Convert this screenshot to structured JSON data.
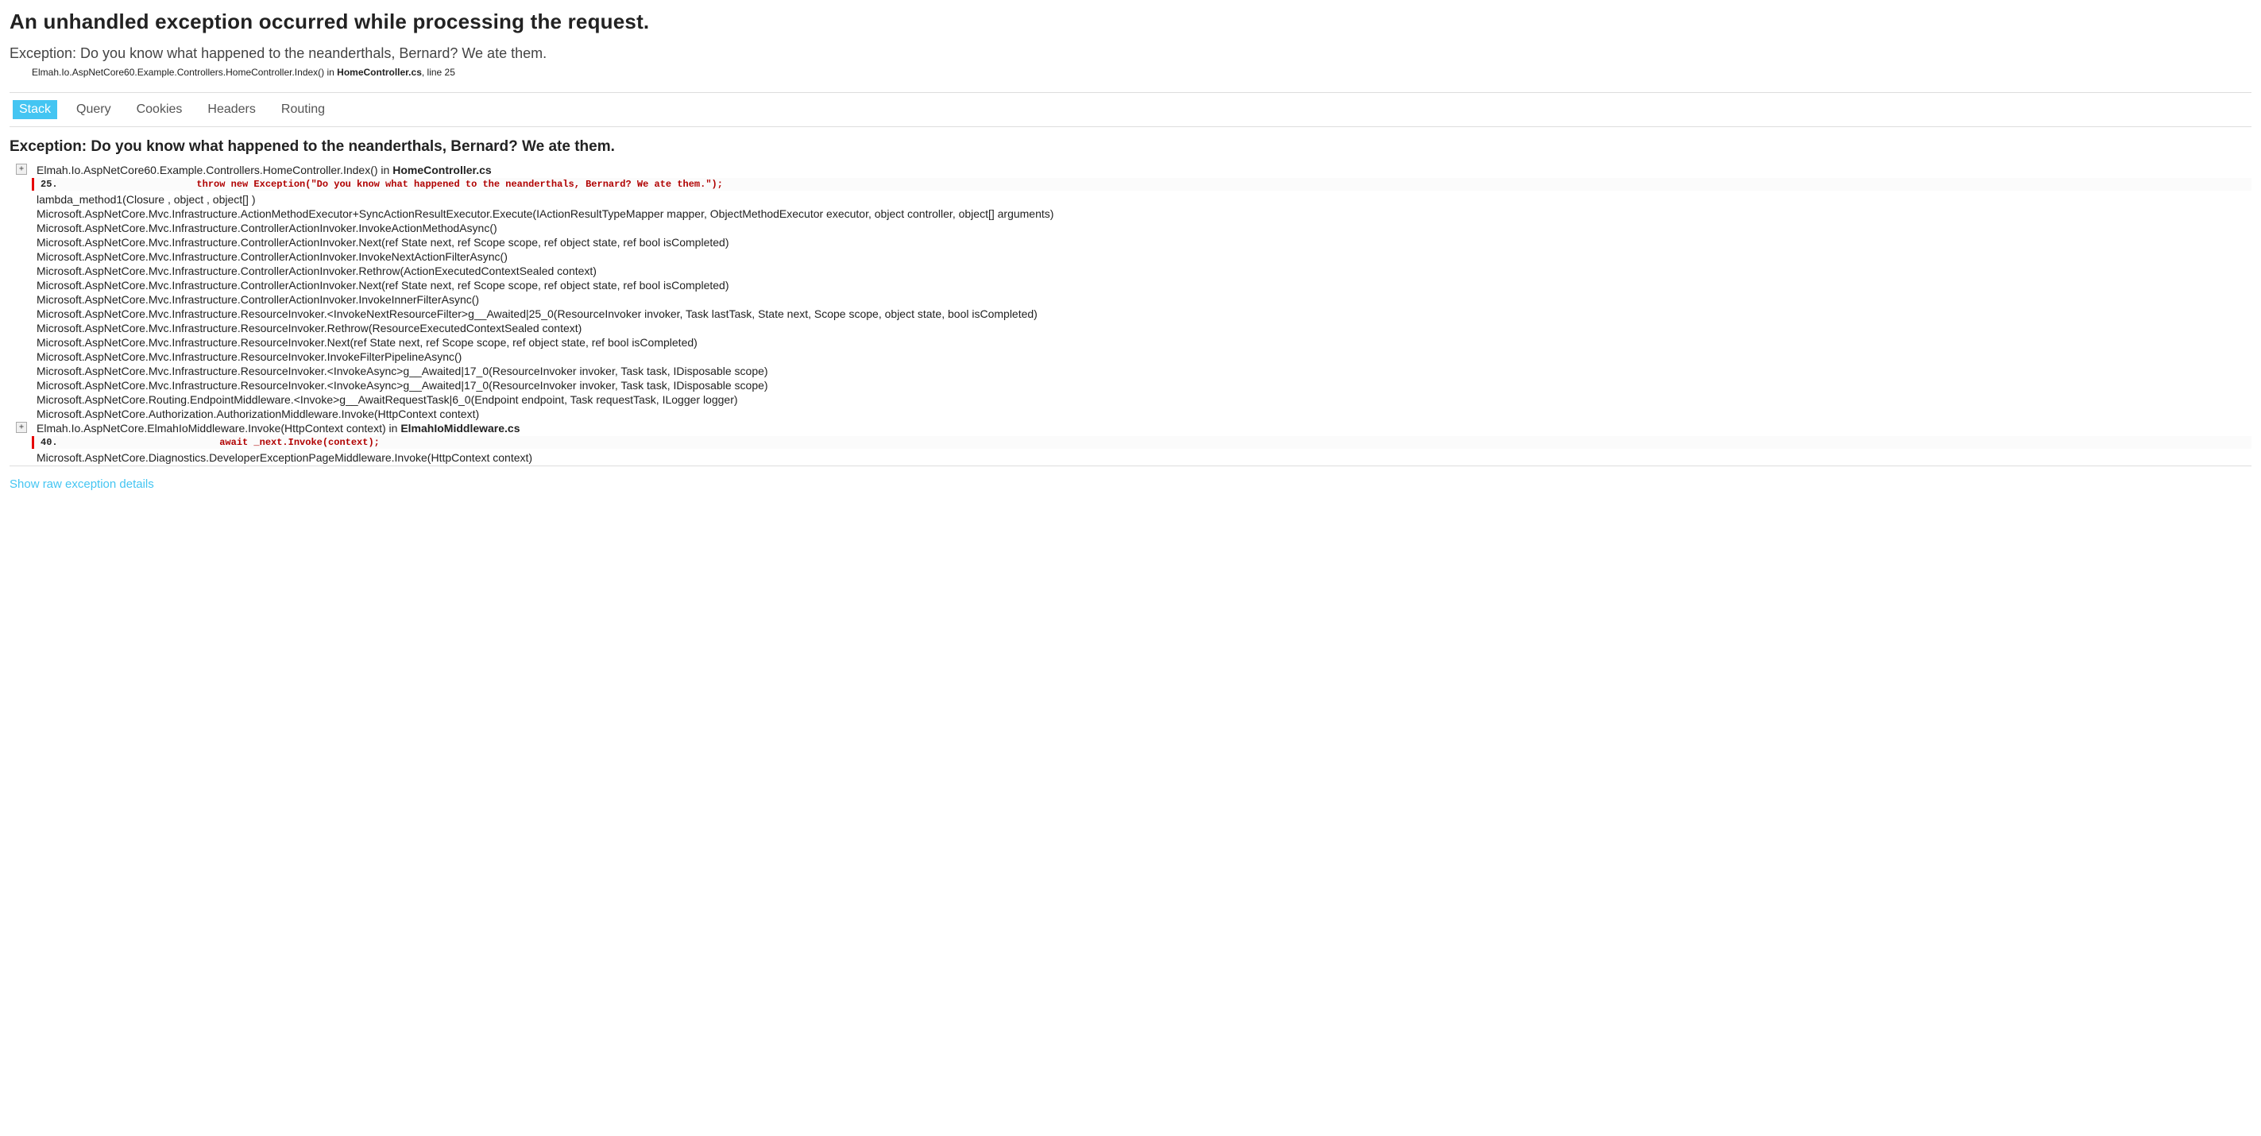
{
  "title": "An unhandled exception occurred while processing the request.",
  "summary": {
    "message": "Exception: Do you know what happened to the neanderthals, Bernard? We ate them.",
    "frame_prefix": "Elmah.Io.AspNetCore60.Example.Controllers.HomeController.Index() in ",
    "frame_file": "HomeController.cs",
    "frame_suffix": ", line 25"
  },
  "tabs": [
    {
      "label": "Stack",
      "active": true
    },
    {
      "label": "Query",
      "active": false
    },
    {
      "label": "Cookies",
      "active": false
    },
    {
      "label": "Headers",
      "active": false
    },
    {
      "label": "Routing",
      "active": false
    }
  ],
  "exception_heading": "Exception: Do you know what happened to the neanderthals, Bernard? We ate them.",
  "frames": [
    {
      "expandable": true,
      "prefix": "Elmah.Io.AspNetCore60.Example.Controllers.HomeController.Index() in ",
      "file": "HomeController.cs",
      "suffix": "",
      "code": {
        "lineno": "25.",
        "src": "            throw new Exception(\"Do you know what happened to the neanderthals, Bernard? We ate them.\");"
      }
    },
    {
      "expandable": false,
      "prefix": "lambda_method1(Closure , object , object[] )",
      "file": "",
      "suffix": ""
    },
    {
      "expandable": false,
      "prefix": "Microsoft.AspNetCore.Mvc.Infrastructure.ActionMethodExecutor+SyncActionResultExecutor.Execute(IActionResultTypeMapper mapper, ObjectMethodExecutor executor, object controller, object[] arguments)",
      "file": "",
      "suffix": ""
    },
    {
      "expandable": false,
      "prefix": "Microsoft.AspNetCore.Mvc.Infrastructure.ControllerActionInvoker.InvokeActionMethodAsync()",
      "file": "",
      "suffix": ""
    },
    {
      "expandable": false,
      "prefix": "Microsoft.AspNetCore.Mvc.Infrastructure.ControllerActionInvoker.Next(ref State next, ref Scope scope, ref object state, ref bool isCompleted)",
      "file": "",
      "suffix": ""
    },
    {
      "expandable": false,
      "prefix": "Microsoft.AspNetCore.Mvc.Infrastructure.ControllerActionInvoker.InvokeNextActionFilterAsync()",
      "file": "",
      "suffix": ""
    },
    {
      "expandable": false,
      "prefix": "Microsoft.AspNetCore.Mvc.Infrastructure.ControllerActionInvoker.Rethrow(ActionExecutedContextSealed context)",
      "file": "",
      "suffix": ""
    },
    {
      "expandable": false,
      "prefix": "Microsoft.AspNetCore.Mvc.Infrastructure.ControllerActionInvoker.Next(ref State next, ref Scope scope, ref object state, ref bool isCompleted)",
      "file": "",
      "suffix": ""
    },
    {
      "expandable": false,
      "prefix": "Microsoft.AspNetCore.Mvc.Infrastructure.ControllerActionInvoker.InvokeInnerFilterAsync()",
      "file": "",
      "suffix": ""
    },
    {
      "expandable": false,
      "prefix": "Microsoft.AspNetCore.Mvc.Infrastructure.ResourceInvoker.<InvokeNextResourceFilter>g__Awaited|25_0(ResourceInvoker invoker, Task lastTask, State next, Scope scope, object state, bool isCompleted)",
      "file": "",
      "suffix": ""
    },
    {
      "expandable": false,
      "prefix": "Microsoft.AspNetCore.Mvc.Infrastructure.ResourceInvoker.Rethrow(ResourceExecutedContextSealed context)",
      "file": "",
      "suffix": ""
    },
    {
      "expandable": false,
      "prefix": "Microsoft.AspNetCore.Mvc.Infrastructure.ResourceInvoker.Next(ref State next, ref Scope scope, ref object state, ref bool isCompleted)",
      "file": "",
      "suffix": ""
    },
    {
      "expandable": false,
      "prefix": "Microsoft.AspNetCore.Mvc.Infrastructure.ResourceInvoker.InvokeFilterPipelineAsync()",
      "file": "",
      "suffix": ""
    },
    {
      "expandable": false,
      "prefix": "Microsoft.AspNetCore.Mvc.Infrastructure.ResourceInvoker.<InvokeAsync>g__Awaited|17_0(ResourceInvoker invoker, Task task, IDisposable scope)",
      "file": "",
      "suffix": ""
    },
    {
      "expandable": false,
      "prefix": "Microsoft.AspNetCore.Mvc.Infrastructure.ResourceInvoker.<InvokeAsync>g__Awaited|17_0(ResourceInvoker invoker, Task task, IDisposable scope)",
      "file": "",
      "suffix": ""
    },
    {
      "expandable": false,
      "prefix": "Microsoft.AspNetCore.Routing.EndpointMiddleware.<Invoke>g__AwaitRequestTask|6_0(Endpoint endpoint, Task requestTask, ILogger logger)",
      "file": "",
      "suffix": ""
    },
    {
      "expandable": false,
      "prefix": "Microsoft.AspNetCore.Authorization.AuthorizationMiddleware.Invoke(HttpContext context)",
      "file": "",
      "suffix": ""
    },
    {
      "expandable": true,
      "prefix": "Elmah.Io.AspNetCore.ElmahIoMiddleware.Invoke(HttpContext context) in ",
      "file": "ElmahIoMiddleware.cs",
      "suffix": "",
      "code": {
        "lineno": "40.",
        "src": "                await _next.Invoke(context);"
      }
    },
    {
      "expandable": false,
      "prefix": "Microsoft.AspNetCore.Diagnostics.DeveloperExceptionPageMiddleware.Invoke(HttpContext context)",
      "file": "",
      "suffix": ""
    }
  ],
  "raw_link": "Show raw exception details",
  "expand_glyph": "+"
}
